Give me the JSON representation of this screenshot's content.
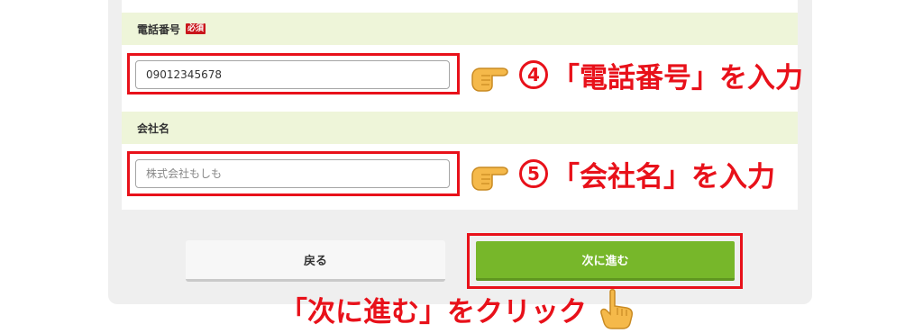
{
  "form": {
    "phone": {
      "label": "電話番号",
      "required_badge": "必須",
      "value": "09012345678",
      "placeholder": "09012345678"
    },
    "company": {
      "label": "会社名",
      "placeholder": "株式会社もしも",
      "value": ""
    }
  },
  "annotations": {
    "phone": {
      "number": "4",
      "text": "「電話番号」を入力"
    },
    "company": {
      "number": "5",
      "text": "「会社名」を入力"
    },
    "click": {
      "text": "「次に進む」をクリック"
    }
  },
  "buttons": {
    "back_label": "戻る",
    "next_label": "次に進む"
  },
  "colors": {
    "accent_red": "#e8111a",
    "next_green": "#77b72a",
    "label_band": "#eef5d9",
    "panel_gray": "#efefef"
  },
  "icons": {
    "pointing_hand": "pointing-right-hand-icon",
    "click_hand": "pointing-up-hand-icon"
  }
}
